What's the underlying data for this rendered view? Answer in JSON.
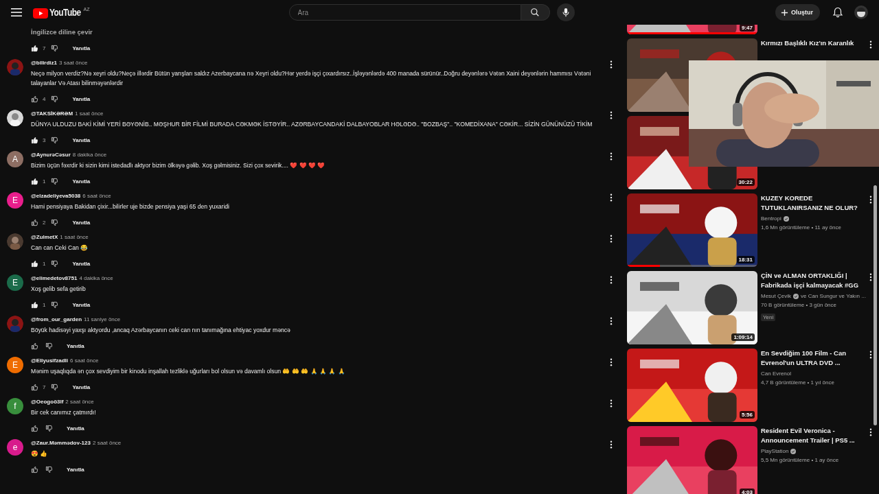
{
  "header": {
    "logo": "YouTube",
    "region": "AZ",
    "search": {
      "placeholder": "Ara"
    },
    "create_button": "Oluştur"
  },
  "comments_top": {
    "translate_link": "İngilizce diline çevir",
    "likes": "7",
    "liked": true,
    "reply": "Yanıtla"
  },
  "comments": [
    {
      "author": "@bilirdiz1",
      "time": "3 saat önce",
      "text": "Neçə milyon verdiz?Nə xeyri oldu?Neçə illərdir Bütün yarışları saldız Azerbaycana nə Xeyri oldu?Hər yerdə işçi çıxardırsız..İşləyənlərdə 400 manada sürünür..Doğru deyənlərə Vətən Xaini deyənlərin hammısı Vətəni talayanlar Və Atası bilinməyənlərdir",
      "likes": "4",
      "liked": false,
      "reply": "Yanıtla"
    },
    {
      "author": "@TAKSİKƏRƏM",
      "time": "1 saat önce",
      "text": "DÜNYA ULDUZU BAKİ KİMİ YERİ BƏYƏNİB..  MƏŞHUR BİR FİLMİ BURADA CƏKMƏK İSTƏYİR..  AZƏRBAYCANDAKİ DALBAYOBLAR HƏLƏDƏ..  \"BOZBAŞ\".. \"KOMEDİXANA\" CƏKİR...  SİZİN GÜNÜNÜZÜ TİKİM",
      "likes": "3",
      "liked": true,
      "reply": "Yanıtla"
    },
    {
      "avatar": {
        "kind": "letter",
        "letter": "A",
        "color": "#8d6e63"
      },
      "author": "@AynurəCəsur",
      "time": "8 dakika önce",
      "text": "Bizim üçün fəxrdir ki sizin kimi istedadlı aktyor bizim ölkəyə gəlib. Xoş gəlmisiniz. Sizi çox sevirik.... ❤️ ❤️ ❤️ ❤️",
      "likes": "1",
      "liked": true,
      "reply": "Yanıtla"
    },
    {
      "avatar": {
        "kind": "letter",
        "letter": "E",
        "color": "#e91e8c"
      },
      "author": "@elzadeliyeva5038",
      "time": "6 saat önce",
      "text": "Hami pensiyaya Bakidan çixir...bilirler uje bizde pensiya yaşi 65 den yuxaridi",
      "likes": "2",
      "liked": false,
      "reply": "Yanıtla"
    },
    {
      "author": "@ZulmetX",
      "time": "1 saat önce",
      "text": "Can can Ceki Can 😂",
      "likes": "1",
      "liked": true,
      "reply": "Yanıtla"
    },
    {
      "avatar": {
        "kind": "letter",
        "letter": "E",
        "color": "#1b6b4a"
      },
      "author": "@elimedetov8751",
      "time": "4 dakika önce",
      "text": "Xoş gelib sefa  getirib",
      "likes": "1",
      "liked": true,
      "reply": "Yanıtla"
    },
    {
      "author": "@from_our_garden",
      "time": "11 saniye önce",
      "text": "Böyük hadisəyi yaxşı aktyordu ,ancaq  Azərbaycanın ceki can nın tanımağına ehtiyac yoxdur məncə",
      "liked": false,
      "reply": "Yanıtla"
    },
    {
      "avatar": {
        "kind": "letter",
        "letter": "E",
        "color": "#ef6c00"
      },
      "author": "@Eliyusifzadli",
      "time": "6 saat önce",
      "text": "Mənim uşaqlıqda ən çox sevdiyim bir kinodu inşallah tezliklə uğurları bol olsun və davamlı olsun 🤲 🤲 🤲 🙏 🙏 🙏 🙏",
      "likes": "7",
      "liked": false,
      "reply": "Yanıtla"
    },
    {
      "avatar": {
        "kind": "letter",
        "letter": "f",
        "color": "#388e3c"
      },
      "author": "@Oeogoö3lf",
      "time": "2 saat önce",
      "text": "Bir cek canımız çatmırdı!",
      "liked": false,
      "reply": "Yanıtla"
    },
    {
      "avatar": {
        "kind": "letter",
        "letter": "e",
        "color": "#d81b8c"
      },
      "author": "@Zaur.Məmmədov-123",
      "time": "2 saat önce",
      "text": "😍 👍",
      "liked": false,
      "reply": "Yanıtla"
    }
  ],
  "sidebar": {
    "partial_video": {
      "duration": "9:47",
      "level": 1
    },
    "videos": [
      {
        "title": "Kırmızı Başlıklı Kız'ın Karanlık"
      },
      {
        "duration": "30:22"
      },
      {
        "title": "KUZEY KOREDE TUTUKLANIRSANIZ NE OLUR?",
        "channel": "Bentropi",
        "verified": true,
        "meta": "1,6 Mn görüntüleme • 11 ay önce",
        "duration": "18:31",
        "level": 0.25
      },
      {
        "title": "ÇİN ve ALMAN ORTAKLIĞI | Fabrikada işçi kalmayacak #GG",
        "channel": "Mesut Çevik",
        "verified": true,
        "channel_extra": "ve Can Sungur ve Yakın ...",
        "meta": "70 B görüntüleme • 3 gün önce",
        "badge": "Yeni",
        "duration": "1:09:14"
      },
      {
        "title": "En Sevdiğim 100 Film - Can Evrenol'un ULTRA DVD ...",
        "channel": "Can Evrenol",
        "meta": "4,7 B görüntüleme • 1 yıl önce",
        "duration": "5:56"
      },
      {
        "title": "Resident Evil Veronica - Announcement Trailer | PS5 ...",
        "channel": "PlayStation",
        "verified": true,
        "meta": "5,5 Mn görüntüleme • 1 ay önce",
        "duration": "4:03"
      }
    ]
  }
}
